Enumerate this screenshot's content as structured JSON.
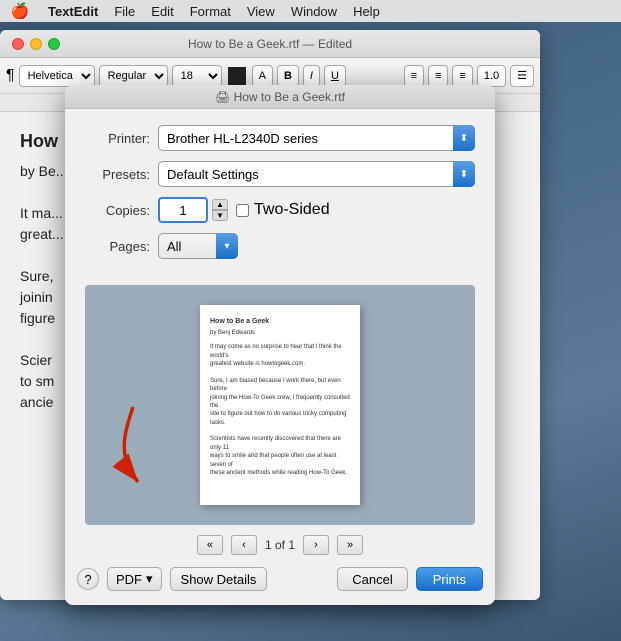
{
  "menubar": {
    "apple": "🍎",
    "app": "TextEdit",
    "items": [
      "File",
      "Edit",
      "Format",
      "View",
      "Window",
      "Help"
    ]
  },
  "textedit": {
    "title": "How to Be a Geek.rtf — Edited",
    "toolbar": {
      "style_indicator": "¶",
      "font": "Helvetica",
      "weight": "Regular",
      "size": "18",
      "bold": "B",
      "italic": "I",
      "underline": "U"
    },
    "content": {
      "heading": "How",
      "subheading": "by Be...",
      "para1": "It ma...",
      "para2": "great...",
      "para3": "Sure,",
      "para4": "joinin",
      "para5": "figure",
      "para6": "Scier",
      "para7": "to sm",
      "para8": "ancie"
    }
  },
  "print_dialog": {
    "title": "🖨 How to Be a Geek.rtf",
    "printer_label": "Printer:",
    "printer_value": "Brother HL-L2340D series",
    "presets_label": "Presets:",
    "presets_value": "Default Settings",
    "copies_label": "Copies:",
    "copies_value": "1",
    "two_sided_label": "Two-Sided",
    "pages_label": "Pages:",
    "pages_value": "All",
    "preview": {
      "title": "How to Be a Geek",
      "author": "by Benj Edwards",
      "line1": "It may come as no surprise to hear that I think the world's",
      "line2": "greatest website is howtogeek.com.",
      "line3": "",
      "line4": "Sure, I am biased because I work there, but even before",
      "line5": "joining the How-To Geek crew, I frequently consulted the",
      "line6": "site to figure out how to do various tricky computing tasks.",
      "line7": "",
      "line8": "Scientists have recently discovered that there are only 11",
      "line9": "ways to smile and that people often use at least seven of",
      "line10": "these ancient methods while reading How-To Geek."
    },
    "nav": {
      "page_text": "1 of 1",
      "first": "«",
      "prev": "‹",
      "next": "›",
      "last": "»"
    },
    "footer": {
      "help": "?",
      "pdf": "PDF",
      "pdf_arrow": "▾",
      "show_details": "Show Details",
      "cancel": "Cancel",
      "print": "Prints"
    }
  }
}
